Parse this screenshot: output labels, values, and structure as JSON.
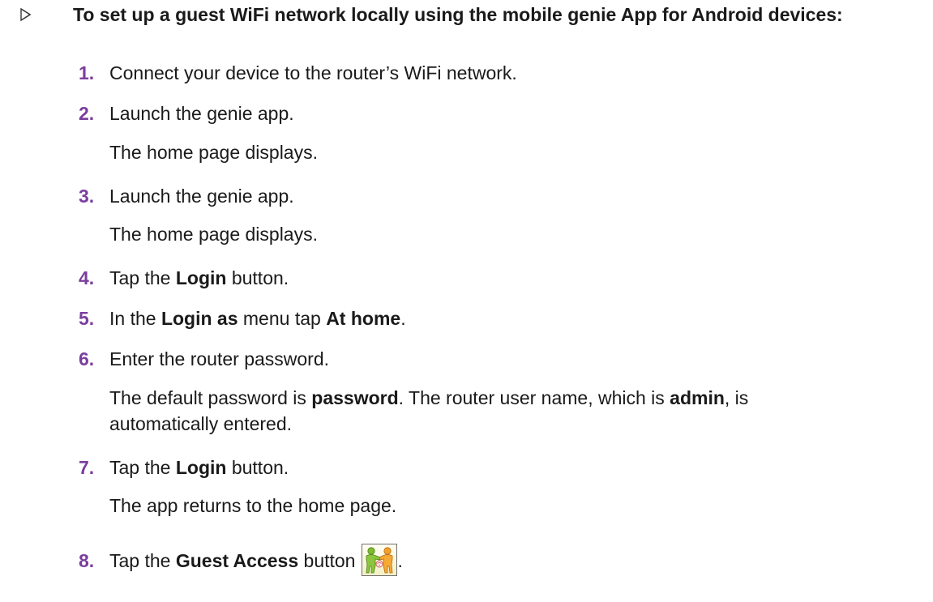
{
  "heading": {
    "text": "To set up a guest WiFi network locally using the mobile genie App for Android devices:"
  },
  "colors": {
    "step_number": "#7a3e9d",
    "text": "#1a1a1a"
  },
  "steps": [
    {
      "number": "1.",
      "parts": [
        {
          "text": "Connect your device to the router’s WiFi network.",
          "bold": false
        }
      ]
    },
    {
      "number": "2.",
      "parts": [
        {
          "text": "Launch the genie app.",
          "bold": false
        }
      ],
      "note": "The home page displays."
    },
    {
      "number": "3.",
      "parts": [
        {
          "text": "Launch the genie app.",
          "bold": false
        }
      ],
      "note": "The home page displays."
    },
    {
      "number": "4.",
      "parts": [
        {
          "text": "Tap the ",
          "bold": false
        },
        {
          "text": "Login",
          "bold": true
        },
        {
          "text": " button.",
          "bold": false
        }
      ]
    },
    {
      "number": "5.",
      "parts": [
        {
          "text": "In the ",
          "bold": false
        },
        {
          "text": "Login as",
          "bold": true
        },
        {
          "text": " menu tap ",
          "bold": false
        },
        {
          "text": "At home",
          "bold": true
        },
        {
          "text": ".",
          "bold": false
        }
      ]
    },
    {
      "number": "6.",
      "parts": [
        {
          "text": "Enter the router password.",
          "bold": false
        }
      ],
      "note_parts": [
        {
          "text": "The default password is ",
          "bold": false
        },
        {
          "text": "password",
          "bold": true
        },
        {
          "text": ". The router user name, which is ",
          "bold": false
        },
        {
          "text": "admin",
          "bold": true
        },
        {
          "text": ", is",
          "bold": false
        },
        {
          "text": "automatically entered.",
          "bold": false
        }
      ]
    },
    {
      "number": "7.",
      "parts": [
        {
          "text": "Tap the ",
          "bold": false
        },
        {
          "text": "Login",
          "bold": true
        },
        {
          "text": " button.",
          "bold": false
        }
      ],
      "note": "The app returns to the home page."
    },
    {
      "number": "8.",
      "parts": [
        {
          "text": "Tap the ",
          "bold": false
        },
        {
          "text": "Guest Access",
          "bold": true
        },
        {
          "text": " button",
          "bold": false
        },
        {
          "text": ".",
          "bold": false
        }
      ],
      "icon": "guest-access-icon"
    }
  ]
}
